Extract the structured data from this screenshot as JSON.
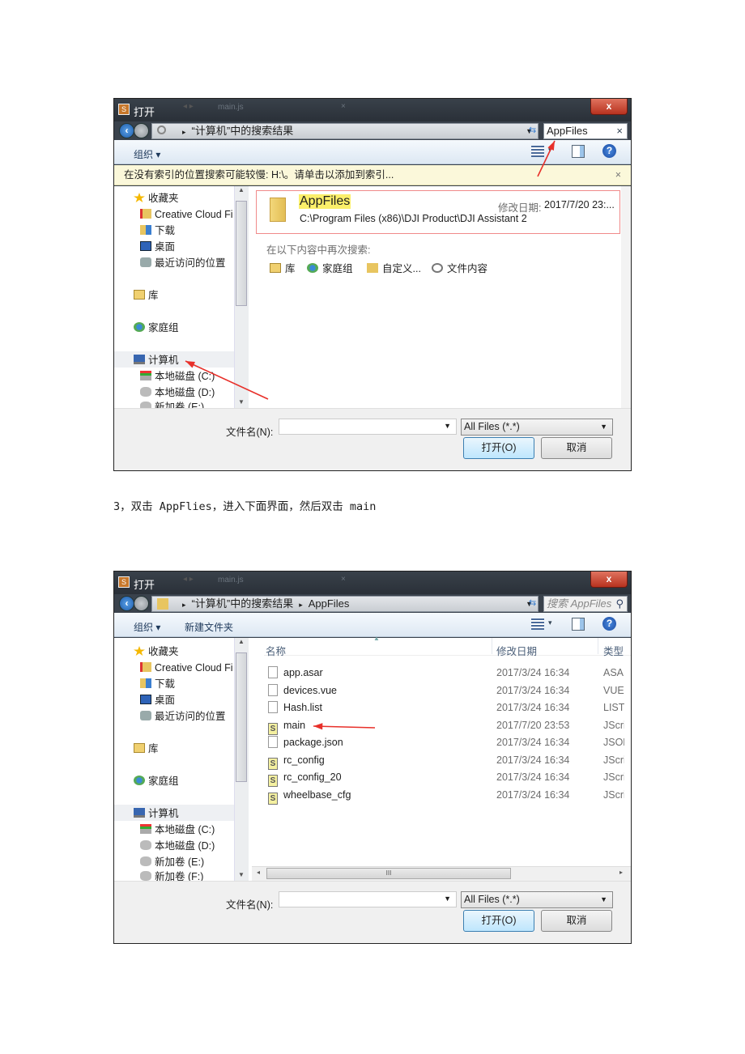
{
  "caption": "3，双击 AppFlies，进入下面界面，然后双击 main",
  "colors": {
    "annotation_arrow": "#e8302a",
    "highlight": "#fbef6a",
    "info_bar": "#fbf8da",
    "close_button": "#c74a35"
  },
  "dialogs": [
    {
      "title": "打开",
      "background_tab": "main.js",
      "address": [
        "“计算机”中的搜索结果"
      ],
      "search_value": "AppFiles",
      "search_placeholder": "",
      "toolbar": {
        "organize": "组织 ▾",
        "new_folder": ""
      },
      "info_bar": "在没有索引的位置搜索可能较慢: H:\\。请单击以添加到索引...",
      "info_close": "×",
      "sidebar": [
        {
          "label": "收藏夹",
          "icon": "star-icon"
        },
        {
          "label": "Creative Cloud Fi",
          "icon": "creative-cloud-folder-icon"
        },
        {
          "label": "下载",
          "icon": "downloads-folder-icon"
        },
        {
          "label": "桌面",
          "icon": "desktop-icon"
        },
        {
          "label": "最近访问的位置",
          "icon": "recent-places-icon"
        },
        {
          "label": "库",
          "icon": "library-icon"
        },
        {
          "label": "家庭组",
          "icon": "homegroup-icon"
        },
        {
          "label": "计算机",
          "icon": "computer-icon",
          "selected": true
        },
        {
          "label": "本地磁盘 (C:)",
          "icon": "system-drive-icon"
        },
        {
          "label": "本地磁盘 (D:)",
          "icon": "drive-icon"
        },
        {
          "label": "新加卷 (E:)",
          "icon": "drive-icon"
        }
      ],
      "search_result": {
        "name": "AppFiles",
        "path": "C:\\Program Files (x86)\\DJI Product\\DJI Assistant 2",
        "date_label": "修改日期:",
        "date": "2017/7/20 23:..."
      },
      "search_again": {
        "label": "在以下内容中再次搜索:",
        "options": [
          {
            "label": "库",
            "icon": "library-icon"
          },
          {
            "label": "家庭组",
            "icon": "homegroup-icon"
          },
          {
            "label": "自定义...",
            "icon": "custom-folder-icon"
          },
          {
            "label": "文件内容",
            "icon": "search-icon"
          }
        ]
      },
      "filename_label": "文件名(N):",
      "filename_value": "",
      "filter": "All Files (*.*)",
      "open_button": "打开(O)",
      "cancel_button": "取消"
    },
    {
      "title": "打开",
      "background_tab": "main.js",
      "address": [
        "“计算机”中的搜索结果",
        "AppFiles"
      ],
      "search_value": "",
      "search_placeholder": "搜索 AppFiles",
      "toolbar": {
        "organize": "组织 ▾",
        "new_folder": "新建文件夹"
      },
      "sidebar": [
        {
          "label": "收藏夹",
          "icon": "star-icon"
        },
        {
          "label": "Creative Cloud Fi",
          "icon": "creative-cloud-folder-icon"
        },
        {
          "label": "下载",
          "icon": "downloads-folder-icon"
        },
        {
          "label": "桌面",
          "icon": "desktop-icon"
        },
        {
          "label": "最近访问的位置",
          "icon": "recent-places-icon"
        },
        {
          "label": "库",
          "icon": "library-icon"
        },
        {
          "label": "家庭组",
          "icon": "homegroup-icon"
        },
        {
          "label": "计算机",
          "icon": "computer-icon",
          "selected": true
        },
        {
          "label": "本地磁盘 (C:)",
          "icon": "system-drive-icon"
        },
        {
          "label": "本地磁盘 (D:)",
          "icon": "drive-icon"
        },
        {
          "label": "新加卷 (E:)",
          "icon": "drive-icon"
        },
        {
          "label": "新加卷 (F:)",
          "icon": "drive-icon"
        }
      ],
      "columns": [
        "名称",
        "修改日期",
        "类型"
      ],
      "files": [
        {
          "name": "app.asar",
          "date": "2017/3/24 16:34",
          "type": "ASAR",
          "icon": "file-icon"
        },
        {
          "name": "devices.vue",
          "date": "2017/3/24 16:34",
          "type": "VUE",
          "icon": "file-icon"
        },
        {
          "name": "Hash.list",
          "date": "2017/3/24 16:34",
          "type": "LIST",
          "icon": "file-icon"
        },
        {
          "name": "main",
          "date": "2017/7/20 23:53",
          "type": "JScrip",
          "icon": "jscript-file-icon"
        },
        {
          "name": "package.json",
          "date": "2017/3/24 16:34",
          "type": "JSON",
          "icon": "file-icon"
        },
        {
          "name": "rc_config",
          "date": "2017/3/24 16:34",
          "type": "JScrip",
          "icon": "jscript-file-icon"
        },
        {
          "name": "rc_config_20",
          "date": "2017/3/24 16:34",
          "type": "JScrip",
          "icon": "jscript-file-icon"
        },
        {
          "name": "wheelbase_cfg",
          "date": "2017/3/24 16:34",
          "type": "JScrip",
          "icon": "jscript-file-icon"
        }
      ],
      "filename_label": "文件名(N):",
      "filename_value": "",
      "filter": "All Files (*.*)",
      "open_button": "打开(O)",
      "cancel_button": "取消"
    }
  ]
}
